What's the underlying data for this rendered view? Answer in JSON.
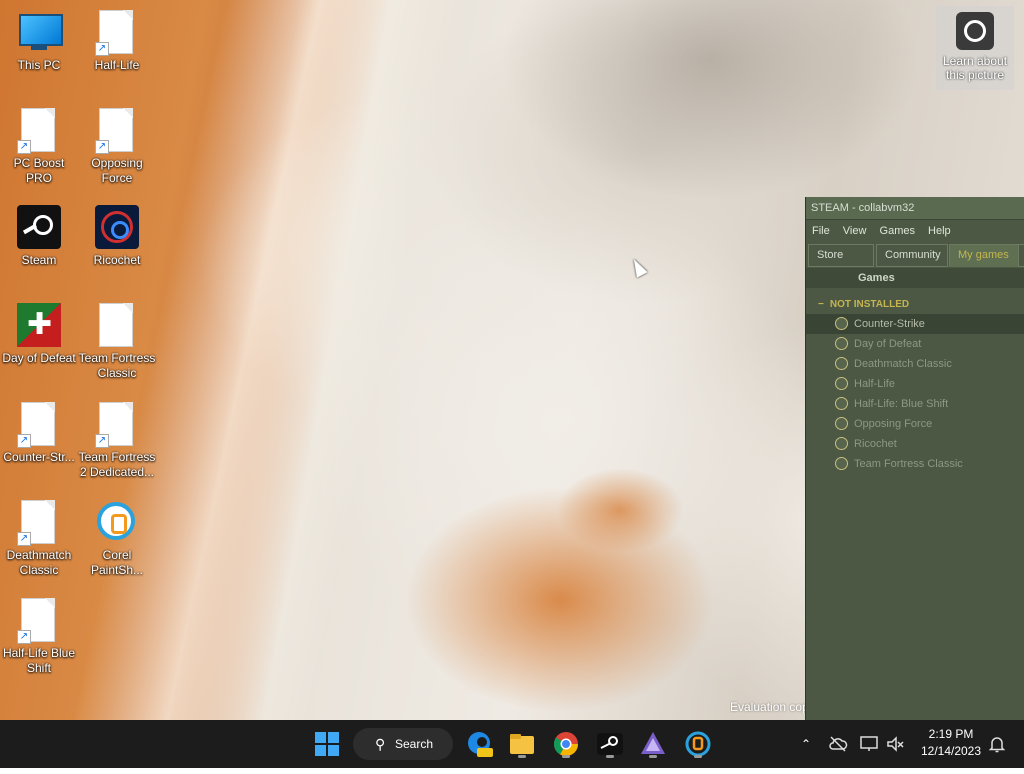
{
  "desktop": {
    "icons": [
      {
        "label": "This PC",
        "icon": "this-pc-icon"
      },
      {
        "label": "Half-Life",
        "icon": "document-shortcut-icon"
      },
      {
        "label": "PC Boost PRO",
        "icon": "document-shortcut-icon"
      },
      {
        "label": "Opposing Force",
        "icon": "document-shortcut-icon"
      },
      {
        "label": "Steam",
        "icon": "steam-icon"
      },
      {
        "label": "Ricochet",
        "icon": "ricochet-icon"
      },
      {
        "label": "Day of Defeat",
        "icon": "day-of-defeat-icon"
      },
      {
        "label": "Team Fortress Classic",
        "icon": "document-shortcut-icon"
      },
      {
        "label": "Counter-Str...",
        "icon": "document-shortcut-icon"
      },
      {
        "label": "Team Fortress 2 Dedicated...",
        "icon": "document-shortcut-icon"
      },
      {
        "label": "Deathmatch Classic",
        "icon": "document-shortcut-icon"
      },
      {
        "label": "Corel PaintSh...",
        "icon": "corel-paintshop-icon"
      },
      {
        "label": "Half-Life Blue Shift",
        "icon": "document-shortcut-icon"
      }
    ],
    "learn_about": "Learn about this picture",
    "watermark": "Evaluation cop"
  },
  "steam": {
    "title": "STEAM - collabvm32",
    "menu": [
      "File",
      "View",
      "Games",
      "Help"
    ],
    "tabs": [
      "Store",
      "Community",
      "My games"
    ],
    "active_tab": "My games",
    "games_header": "Games",
    "section": "NOT INSTALLED",
    "section_toggle": "−",
    "games": [
      {
        "name": "Counter-Strike",
        "selected": true
      },
      {
        "name": "Day of Defeat",
        "selected": false
      },
      {
        "name": "Deathmatch Classic",
        "selected": false
      },
      {
        "name": "Half-Life",
        "selected": false
      },
      {
        "name": "Half-Life: Blue Shift",
        "selected": false
      },
      {
        "name": "Opposing Force",
        "selected": false
      },
      {
        "name": "Ricochet",
        "selected": false
      },
      {
        "name": "Team Fortress Classic",
        "selected": false
      }
    ]
  },
  "taskbar": {
    "search_label": "Search",
    "time": "2:19 PM",
    "date": "12/14/2023",
    "apps": [
      "edge-preview-icon",
      "file-explorer-icon",
      "chrome-icon",
      "steam-icon",
      "affinity-icon",
      "corel-paintshop-icon"
    ],
    "tray": [
      "chevron-up-icon",
      "onedrive-off-icon",
      "network-icon",
      "volume-muted-icon",
      "notification-bell-icon"
    ]
  },
  "colors": {
    "steam_bg": "#4c5844",
    "steam_accent": "#c4b550",
    "taskbar_bg": "#1c1c1c"
  }
}
